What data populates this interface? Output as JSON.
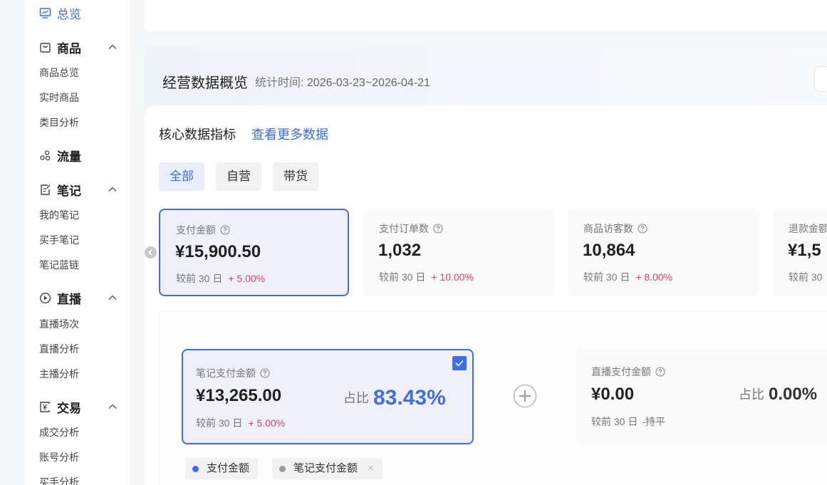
{
  "sidebar": {
    "overview": {
      "label": "总览",
      "icon": "monitor-icon"
    },
    "sections": [
      {
        "label": "商品",
        "icon": "bag-icon",
        "expanded": true,
        "items": [
          "商品总览",
          "实时商品",
          "类目分析"
        ]
      },
      {
        "label": "流量",
        "icon": "flow-icon",
        "expanded": false,
        "items": []
      },
      {
        "label": "笔记",
        "icon": "note-icon",
        "expanded": true,
        "items": [
          "我的笔记",
          "买手笔记",
          "笔记蓝链"
        ]
      },
      {
        "label": "直播",
        "icon": "play-icon",
        "expanded": true,
        "items": [
          "直播场次",
          "直播分析",
          "主播分析"
        ]
      },
      {
        "label": "交易",
        "icon": "yen-icon",
        "expanded": true,
        "items": [
          "成交分析",
          "账号分析",
          "买手分析"
        ]
      }
    ]
  },
  "main": {
    "title": "经营数据概览",
    "stat_time_label": "统计时间:",
    "stat_time_value": "2026-03-23~2026-04-21",
    "core_title": "核心数据指标",
    "more_link": "查看更多数据",
    "tabs": [
      {
        "label": "全部",
        "active": true
      },
      {
        "label": "自营",
        "active": false
      },
      {
        "label": "带货",
        "active": false
      }
    ],
    "metrics": [
      {
        "label": "支付金额",
        "value": "¥15,900.50",
        "cmp_label": "较前 30 日",
        "change": "+ 5.00%",
        "active": true
      },
      {
        "label": "支付订单数",
        "value": "1,032",
        "cmp_label": "较前 30 日",
        "change": "+ 10.00%",
        "active": false
      },
      {
        "label": "商品访客数",
        "value": "10,864",
        "cmp_label": "较前 30 日",
        "change": "+ 8.00%",
        "active": false
      },
      {
        "label": "退款金额",
        "value": "¥1,5",
        "cmp_label": "较前 30",
        "change": "",
        "active": false
      }
    ],
    "sub_metrics": [
      {
        "label": "笔记支付金额",
        "value": "¥13,265.00",
        "ratio_label": "占比",
        "ratio": "83.43%",
        "cmp_label": "较前 30 日",
        "change": "+ 5.00%",
        "active": true
      },
      {
        "label": "直播支付金额",
        "value": "¥0.00",
        "ratio_label": "占比",
        "ratio": "0.00%",
        "cmp_label": "较前 30 日",
        "change": "-持平",
        "active": false
      }
    ],
    "legend": [
      {
        "label": "支付金额",
        "color": "#3f6ee8"
      },
      {
        "label": "笔记支付金额",
        "color": "#999999",
        "closable": true
      }
    ]
  },
  "colors": {
    "accent": "#3f6ee8",
    "up": "#e0445a"
  }
}
